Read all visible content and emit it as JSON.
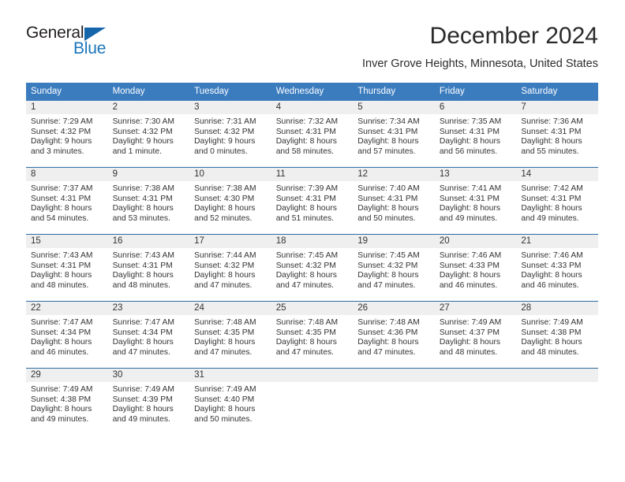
{
  "logo": {
    "word_one": "General",
    "word_two": "Blue",
    "triangle": "blue-triangle-icon",
    "brand_color": "#1b75bb"
  },
  "header": {
    "month_title": "December 2024",
    "location": "Inver Grove Heights, Minnesota, United States"
  },
  "calendar": {
    "header_color": "#3b7cbf",
    "weekdays": [
      "Sunday",
      "Monday",
      "Tuesday",
      "Wednesday",
      "Thursday",
      "Friday",
      "Saturday"
    ],
    "weeks": [
      [
        {
          "day": "1",
          "sunrise": "Sunrise: 7:29 AM",
          "sunset": "Sunset: 4:32 PM",
          "daylight_line1": "Daylight: 9 hours",
          "daylight_line2": "and 3 minutes."
        },
        {
          "day": "2",
          "sunrise": "Sunrise: 7:30 AM",
          "sunset": "Sunset: 4:32 PM",
          "daylight_line1": "Daylight: 9 hours",
          "daylight_line2": "and 1 minute."
        },
        {
          "day": "3",
          "sunrise": "Sunrise: 7:31 AM",
          "sunset": "Sunset: 4:32 PM",
          "daylight_line1": "Daylight: 9 hours",
          "daylight_line2": "and 0 minutes."
        },
        {
          "day": "4",
          "sunrise": "Sunrise: 7:32 AM",
          "sunset": "Sunset: 4:31 PM",
          "daylight_line1": "Daylight: 8 hours",
          "daylight_line2": "and 58 minutes."
        },
        {
          "day": "5",
          "sunrise": "Sunrise: 7:34 AM",
          "sunset": "Sunset: 4:31 PM",
          "daylight_line1": "Daylight: 8 hours",
          "daylight_line2": "and 57 minutes."
        },
        {
          "day": "6",
          "sunrise": "Sunrise: 7:35 AM",
          "sunset": "Sunset: 4:31 PM",
          "daylight_line1": "Daylight: 8 hours",
          "daylight_line2": "and 56 minutes."
        },
        {
          "day": "7",
          "sunrise": "Sunrise: 7:36 AM",
          "sunset": "Sunset: 4:31 PM",
          "daylight_line1": "Daylight: 8 hours",
          "daylight_line2": "and 55 minutes."
        }
      ],
      [
        {
          "day": "8",
          "sunrise": "Sunrise: 7:37 AM",
          "sunset": "Sunset: 4:31 PM",
          "daylight_line1": "Daylight: 8 hours",
          "daylight_line2": "and 54 minutes."
        },
        {
          "day": "9",
          "sunrise": "Sunrise: 7:38 AM",
          "sunset": "Sunset: 4:31 PM",
          "daylight_line1": "Daylight: 8 hours",
          "daylight_line2": "and 53 minutes."
        },
        {
          "day": "10",
          "sunrise": "Sunrise: 7:38 AM",
          "sunset": "Sunset: 4:30 PM",
          "daylight_line1": "Daylight: 8 hours",
          "daylight_line2": "and 52 minutes."
        },
        {
          "day": "11",
          "sunrise": "Sunrise: 7:39 AM",
          "sunset": "Sunset: 4:31 PM",
          "daylight_line1": "Daylight: 8 hours",
          "daylight_line2": "and 51 minutes."
        },
        {
          "day": "12",
          "sunrise": "Sunrise: 7:40 AM",
          "sunset": "Sunset: 4:31 PM",
          "daylight_line1": "Daylight: 8 hours",
          "daylight_line2": "and 50 minutes."
        },
        {
          "day": "13",
          "sunrise": "Sunrise: 7:41 AM",
          "sunset": "Sunset: 4:31 PM",
          "daylight_line1": "Daylight: 8 hours",
          "daylight_line2": "and 49 minutes."
        },
        {
          "day": "14",
          "sunrise": "Sunrise: 7:42 AM",
          "sunset": "Sunset: 4:31 PM",
          "daylight_line1": "Daylight: 8 hours",
          "daylight_line2": "and 49 minutes."
        }
      ],
      [
        {
          "day": "15",
          "sunrise": "Sunrise: 7:43 AM",
          "sunset": "Sunset: 4:31 PM",
          "daylight_line1": "Daylight: 8 hours",
          "daylight_line2": "and 48 minutes."
        },
        {
          "day": "16",
          "sunrise": "Sunrise: 7:43 AM",
          "sunset": "Sunset: 4:31 PM",
          "daylight_line1": "Daylight: 8 hours",
          "daylight_line2": "and 48 minutes."
        },
        {
          "day": "17",
          "sunrise": "Sunrise: 7:44 AM",
          "sunset": "Sunset: 4:32 PM",
          "daylight_line1": "Daylight: 8 hours",
          "daylight_line2": "and 47 minutes."
        },
        {
          "day": "18",
          "sunrise": "Sunrise: 7:45 AM",
          "sunset": "Sunset: 4:32 PM",
          "daylight_line1": "Daylight: 8 hours",
          "daylight_line2": "and 47 minutes."
        },
        {
          "day": "19",
          "sunrise": "Sunrise: 7:45 AM",
          "sunset": "Sunset: 4:32 PM",
          "daylight_line1": "Daylight: 8 hours",
          "daylight_line2": "and 47 minutes."
        },
        {
          "day": "20",
          "sunrise": "Sunrise: 7:46 AM",
          "sunset": "Sunset: 4:33 PM",
          "daylight_line1": "Daylight: 8 hours",
          "daylight_line2": "and 46 minutes."
        },
        {
          "day": "21",
          "sunrise": "Sunrise: 7:46 AM",
          "sunset": "Sunset: 4:33 PM",
          "daylight_line1": "Daylight: 8 hours",
          "daylight_line2": "and 46 minutes."
        }
      ],
      [
        {
          "day": "22",
          "sunrise": "Sunrise: 7:47 AM",
          "sunset": "Sunset: 4:34 PM",
          "daylight_line1": "Daylight: 8 hours",
          "daylight_line2": "and 46 minutes."
        },
        {
          "day": "23",
          "sunrise": "Sunrise: 7:47 AM",
          "sunset": "Sunset: 4:34 PM",
          "daylight_line1": "Daylight: 8 hours",
          "daylight_line2": "and 47 minutes."
        },
        {
          "day": "24",
          "sunrise": "Sunrise: 7:48 AM",
          "sunset": "Sunset: 4:35 PM",
          "daylight_line1": "Daylight: 8 hours",
          "daylight_line2": "and 47 minutes."
        },
        {
          "day": "25",
          "sunrise": "Sunrise: 7:48 AM",
          "sunset": "Sunset: 4:35 PM",
          "daylight_line1": "Daylight: 8 hours",
          "daylight_line2": "and 47 minutes."
        },
        {
          "day": "26",
          "sunrise": "Sunrise: 7:48 AM",
          "sunset": "Sunset: 4:36 PM",
          "daylight_line1": "Daylight: 8 hours",
          "daylight_line2": "and 47 minutes."
        },
        {
          "day": "27",
          "sunrise": "Sunrise: 7:49 AM",
          "sunset": "Sunset: 4:37 PM",
          "daylight_line1": "Daylight: 8 hours",
          "daylight_line2": "and 48 minutes."
        },
        {
          "day": "28",
          "sunrise": "Sunrise: 7:49 AM",
          "sunset": "Sunset: 4:38 PM",
          "daylight_line1": "Daylight: 8 hours",
          "daylight_line2": "and 48 minutes."
        }
      ],
      [
        {
          "day": "29",
          "sunrise": "Sunrise: 7:49 AM",
          "sunset": "Sunset: 4:38 PM",
          "daylight_line1": "Daylight: 8 hours",
          "daylight_line2": "and 49 minutes."
        },
        {
          "day": "30",
          "sunrise": "Sunrise: 7:49 AM",
          "sunset": "Sunset: 4:39 PM",
          "daylight_line1": "Daylight: 8 hours",
          "daylight_line2": "and 49 minutes."
        },
        {
          "day": "31",
          "sunrise": "Sunrise: 7:49 AM",
          "sunset": "Sunset: 4:40 PM",
          "daylight_line1": "Daylight: 8 hours",
          "daylight_line2": "and 50 minutes."
        },
        {
          "day": "",
          "sunrise": "",
          "sunset": "",
          "daylight_line1": "",
          "daylight_line2": ""
        },
        {
          "day": "",
          "sunrise": "",
          "sunset": "",
          "daylight_line1": "",
          "daylight_line2": ""
        },
        {
          "day": "",
          "sunrise": "",
          "sunset": "",
          "daylight_line1": "",
          "daylight_line2": ""
        },
        {
          "day": "",
          "sunrise": "",
          "sunset": "",
          "daylight_line1": "",
          "daylight_line2": ""
        }
      ]
    ]
  }
}
